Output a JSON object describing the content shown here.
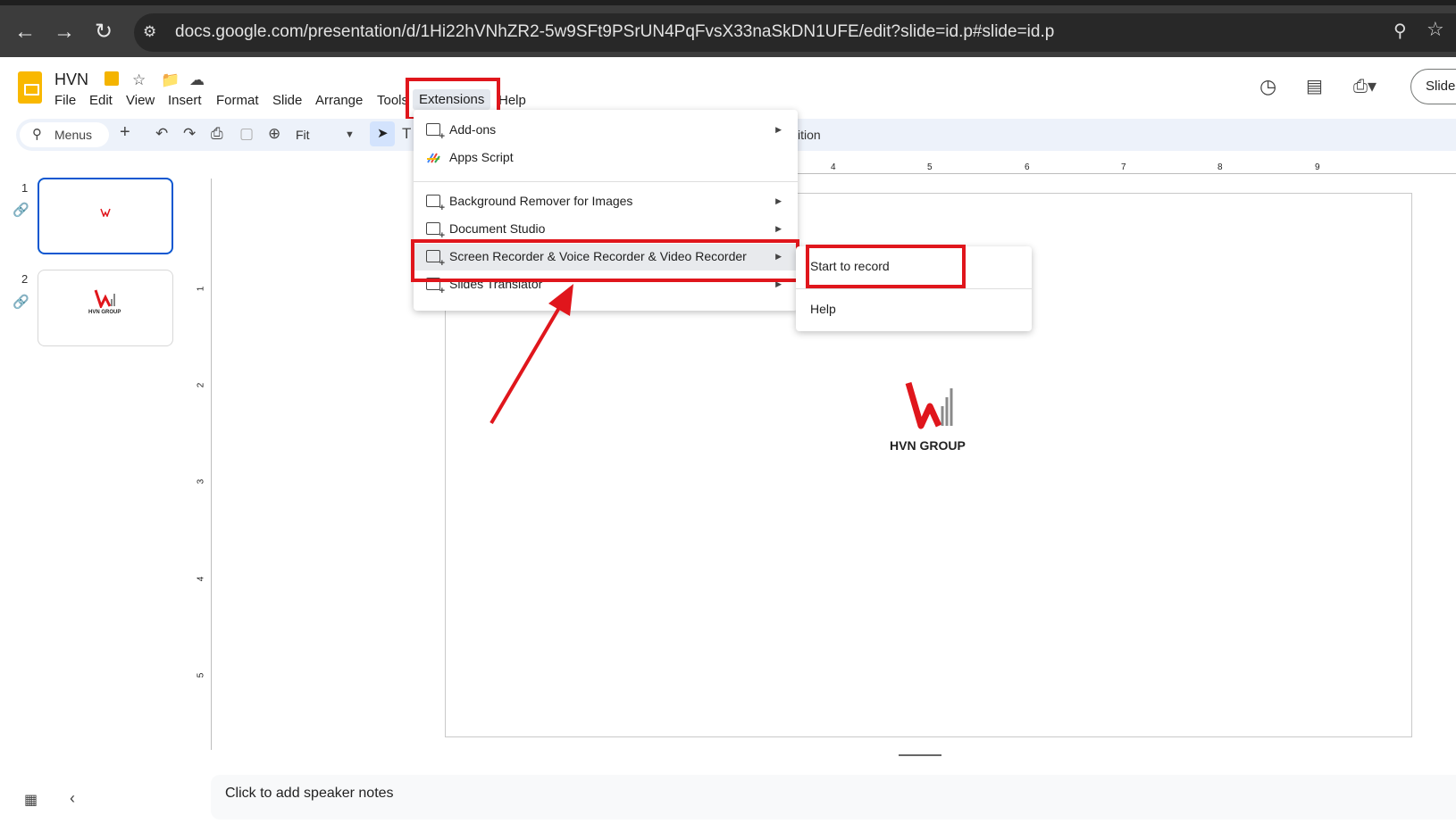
{
  "browser": {
    "back_icon": "arrow-left-icon",
    "forward_icon": "arrow-right-icon",
    "reload_icon": "reload-icon",
    "url": "docs.google.com/presentation/d/1Hi22hVNhZR2-5w9SFt9PSrUN4PqFvsX33naSkDN1UFE/edit?slide=id.p#slide=id.p"
  },
  "app": {
    "title": "HVN",
    "menus": [
      "File",
      "Edit",
      "View",
      "Insert",
      "Format",
      "Slide",
      "Arrange",
      "Tools",
      "Extensions",
      "Help"
    ],
    "slideshow_label": "Slides"
  },
  "toolbar": {
    "search_label": "Menus",
    "zoom_label": "Fit",
    "transition_fragment": "ition"
  },
  "ruler": {
    "h_ticks": [
      "4",
      "5",
      "6",
      "7",
      "8",
      "9"
    ],
    "v_ticks": [
      "1",
      "2",
      "3",
      "4",
      "5"
    ]
  },
  "filmstrip": {
    "slides": [
      {
        "number": "1"
      },
      {
        "number": "2",
        "caption": "HVN GROUP"
      }
    ]
  },
  "slide": {
    "logo_text": "HVN GROUP"
  },
  "notes_placeholder": "Click to add speaker notes",
  "extensions_menu": {
    "items": [
      {
        "label": "Add-ons",
        "has_submenu": true
      },
      {
        "label": "Apps Script",
        "has_submenu": false
      },
      {
        "label": "Background Remover for Images",
        "has_submenu": true
      },
      {
        "label": "Document Studio",
        "has_submenu": true
      },
      {
        "label": "Screen Recorder & Voice Recorder & Video Recorder",
        "has_submenu": true
      },
      {
        "label": "Slides Translator",
        "has_submenu": true
      }
    ]
  },
  "sub_menu": {
    "items": [
      "Start to record",
      "Help"
    ]
  },
  "colors": {
    "highlight": "#e0161c",
    "slides_yellow": "#f9b800",
    "selected_blue": "#0b57d0"
  }
}
